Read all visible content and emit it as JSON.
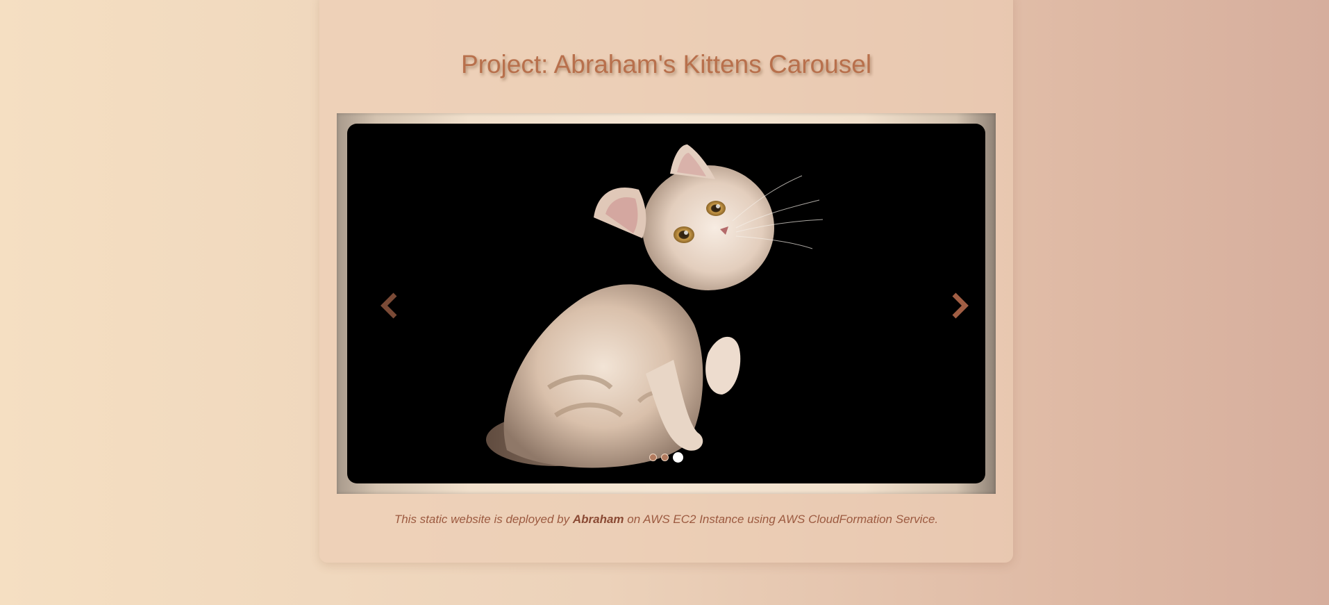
{
  "page": {
    "title": "Project: Abraham's Kittens Carousel"
  },
  "carousel": {
    "prev_icon": "chevron-left-icon",
    "next_icon": "chevron-right-icon",
    "slide_count": 3,
    "active_slide": 3,
    "indicators": [
      "slide-1",
      "slide-2",
      "slide-3"
    ],
    "arrow_color": "#8a4e38"
  },
  "footer": {
    "text_before": "This static website is deployed by ",
    "author": "Abraham",
    "text_after": " on AWS EC2 Instance using AWS CloudFormation Service."
  },
  "colors": {
    "title": "#b8704c",
    "footer_text": "#9c5a40",
    "background_left": "#f5dfc2",
    "background_right": "#d6ae9d"
  }
}
